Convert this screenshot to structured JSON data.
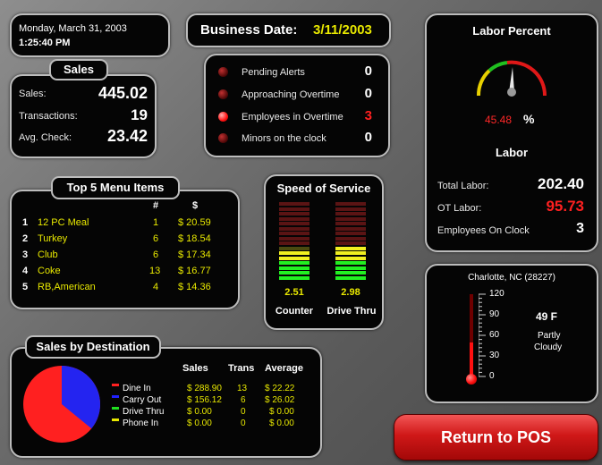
{
  "header": {
    "date": "Monday, March 31, 2003",
    "time": "1:25:40 PM",
    "business_date_label": "Business Date:",
    "business_date": "3/11/2003"
  },
  "sales": {
    "title": "Sales",
    "rows": [
      {
        "label": "Sales:",
        "value": "445.02"
      },
      {
        "label": "Transactions:",
        "value": "19"
      },
      {
        "label": "Avg. Check:",
        "value": "23.42"
      }
    ]
  },
  "alerts": {
    "rows": [
      {
        "label": "Pending Alerts",
        "value": "0",
        "active": false
      },
      {
        "label": "Approaching Overtime",
        "value": "0",
        "active": false
      },
      {
        "label": "Employees in Overtime",
        "value": "3",
        "active": true
      },
      {
        "label": "Minors on the clock",
        "value": "0",
        "active": false
      }
    ]
  },
  "labor_percent": {
    "title": "Labor Percent",
    "value": "45.48",
    "unit": "%",
    "labor_title": "Labor",
    "rows": [
      {
        "label": "Total Labor:",
        "value": "202.40"
      },
      {
        "label": "OT Labor:",
        "value": "95.73"
      },
      {
        "label": "Employees On Clock",
        "value": "3"
      }
    ]
  },
  "top_menu": {
    "title": "Top 5 Menu Items",
    "col_count": "#",
    "col_amount": "$",
    "items": [
      {
        "rank": "1",
        "name": "12 PC Meal",
        "count": "1",
        "amount": "$ 20.59"
      },
      {
        "rank": "2",
        "name": "Turkey",
        "count": "6",
        "amount": "$ 18.54"
      },
      {
        "rank": "3",
        "name": "Club",
        "count": "6",
        "amount": "$ 17.34"
      },
      {
        "rank": "4",
        "name": "Coke",
        "count": "13",
        "amount": "$ 16.77"
      },
      {
        "rank": "5",
        "name": "RB,American",
        "count": "4",
        "amount": "$ 14.36"
      }
    ]
  },
  "speed_of_service": {
    "title": "Speed of Service",
    "counter": {
      "value": "2.51",
      "label": "Counter",
      "level": 0.38
    },
    "drive_thru": {
      "value": "2.98",
      "label": "Drive Thru",
      "level": 0.44
    }
  },
  "weather": {
    "location": "Charlotte, NC (28227)",
    "temperature": "49 F",
    "condition_line1": "Partly",
    "condition_line2": "Cloudy",
    "scale": [
      "120",
      "90",
      "60",
      "30",
      "0"
    ],
    "temperature_value": 49
  },
  "sales_by_destination": {
    "title": "Sales by Destination",
    "col_sales": "Sales",
    "col_trans": "Trans",
    "col_average": "Average",
    "rows": [
      {
        "name": "Dine In",
        "sales": "$ 288.90",
        "trans": "13",
        "average": "$ 22.22",
        "color": "#ff2020"
      },
      {
        "name": "Carry Out",
        "sales": "$ 156.12",
        "trans": "6",
        "average": "$ 26.02",
        "color": "#2020ff"
      },
      {
        "name": "Drive Thru",
        "sales": "$ 0.00",
        "trans": "0",
        "average": "$ 0.00",
        "color": "#20e020"
      },
      {
        "name": "Phone In",
        "sales": "$ 0.00",
        "trans": "0",
        "average": "$ 0.00",
        "color": "#e8e800"
      }
    ]
  },
  "return_button": {
    "label": "Return to POS"
  }
}
